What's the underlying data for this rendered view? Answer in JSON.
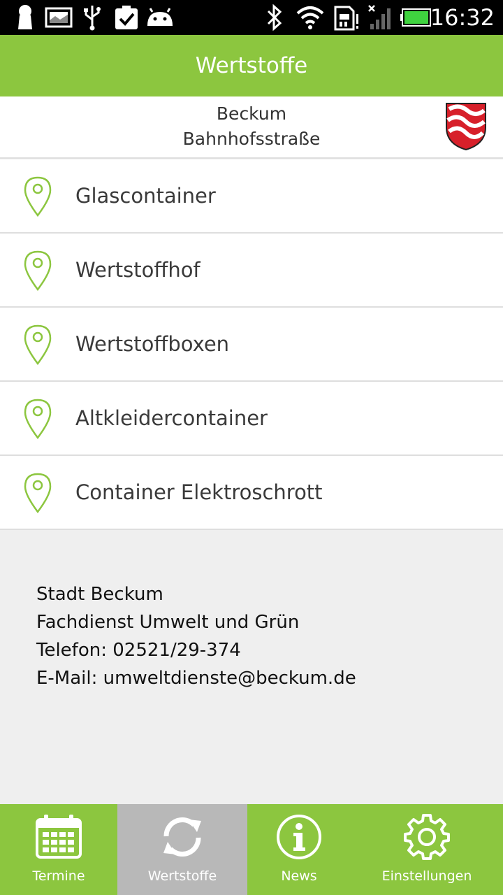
{
  "status_bar": {
    "time": "16:32",
    "icons": [
      "keyhole-icon",
      "image-icon",
      "usb-icon",
      "clipboard-check-icon",
      "android-icon",
      "bluetooth-icon",
      "wifi-icon",
      "sim-alert-icon",
      "signal-icon",
      "battery-icon"
    ]
  },
  "app_bar": {
    "title": "Wertstoffe"
  },
  "location": {
    "city": "Beckum",
    "street": "Bahnhofsstraße",
    "crest_icon": "coat-of-arms-icon"
  },
  "list": {
    "items": [
      {
        "label": "Glascontainer",
        "icon": "map-pin-icon"
      },
      {
        "label": "Wertstoffhof",
        "icon": "map-pin-icon"
      },
      {
        "label": "Wertstoffboxen",
        "icon": "map-pin-icon"
      },
      {
        "label": "Altkleidercontainer",
        "icon": "map-pin-icon"
      },
      {
        "label": "Container Elektroschrott",
        "icon": "map-pin-icon"
      }
    ]
  },
  "contact": {
    "line1": "Stadt Beckum",
    "line2": "Fachdienst Umwelt und Grün",
    "line3": "Telefon: 02521/29-374",
    "line4": "E-Mail: umweltdienste@beckum.de"
  },
  "tabs": [
    {
      "label": "Termine",
      "icon": "calendar-icon",
      "active": false
    },
    {
      "label": "Wertstoffe",
      "icon": "refresh-icon",
      "active": true
    },
    {
      "label": "News",
      "icon": "info-icon",
      "active": false
    },
    {
      "label": "Einstellungen",
      "icon": "gear-icon",
      "active": false
    }
  ],
  "colors": {
    "accent": "#8cc63f",
    "active_tab": "#b8b8b8",
    "background": "#efefef",
    "crest_red": "#d7202a"
  }
}
